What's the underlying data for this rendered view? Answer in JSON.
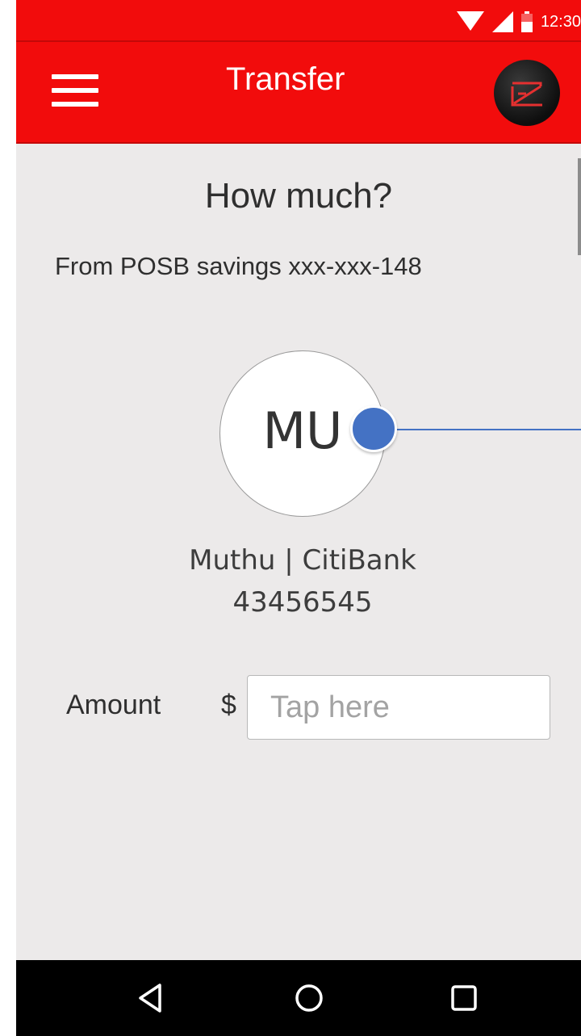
{
  "status_bar": {
    "time": "12:30",
    "icons": [
      "wifi-icon",
      "signal-icon",
      "battery-icon"
    ],
    "color": "#F20C0C"
  },
  "app_bar": {
    "title": "Transfer",
    "menu_icon": "hamburger-menu-icon",
    "logo": "ez-logo"
  },
  "main": {
    "heading": "How much?",
    "from_account": "From POSB savings xxx-xxx-148",
    "payee": {
      "initials": "MU",
      "name_bank": "Muthu | CitiBank",
      "account_number": "43456545"
    },
    "amount": {
      "label": "Amount",
      "currency_symbol": "$",
      "placeholder": "Tap here",
      "value": ""
    }
  },
  "nav_bar": {
    "buttons": [
      "back-triangle-icon",
      "home-circle-icon",
      "recents-square-icon"
    ]
  },
  "colors": {
    "brand_red": "#F20C0C",
    "background": "#ECEAEA",
    "annotation_blue": "#4472C4"
  }
}
